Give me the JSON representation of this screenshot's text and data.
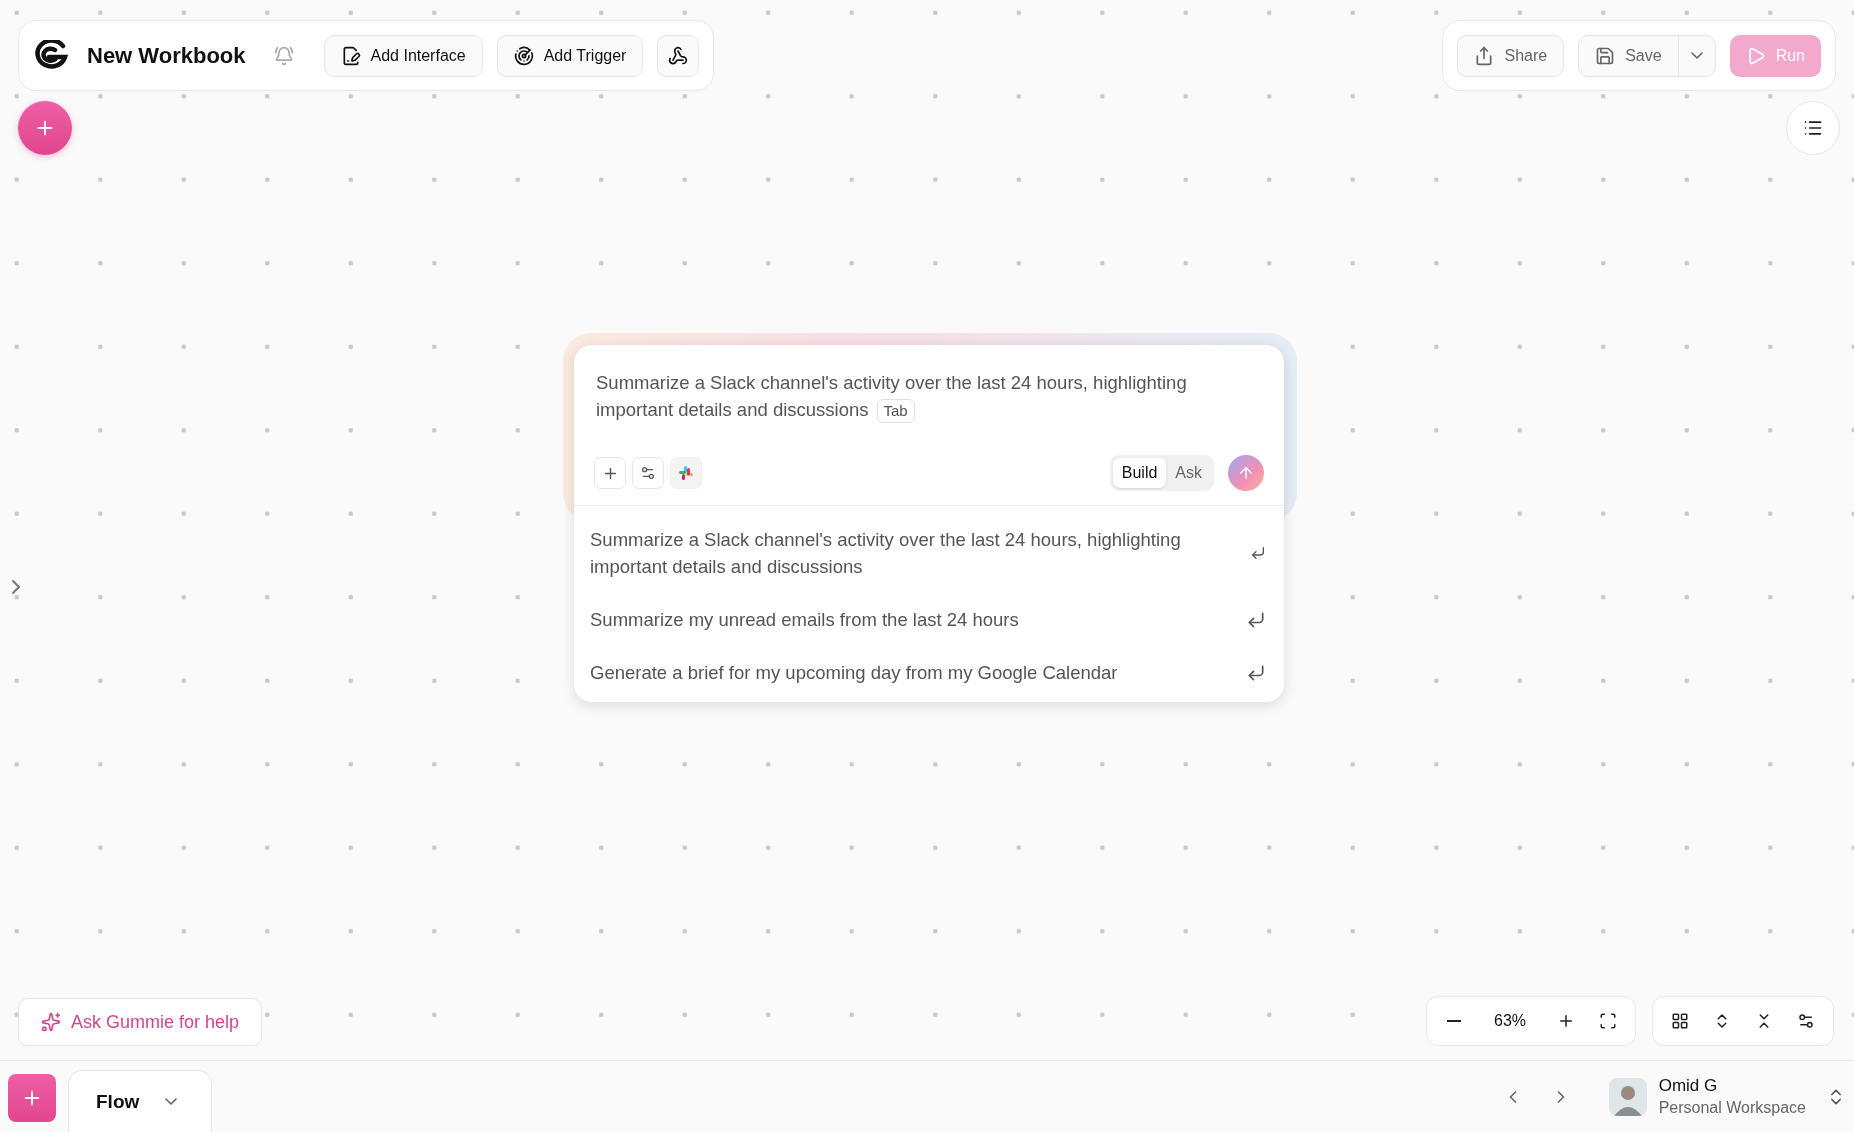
{
  "header": {
    "title": "New Workbook",
    "buttons": [
      {
        "label": "Add Interface",
        "kind": "interface"
      },
      {
        "label": "Add Trigger",
        "kind": "trigger"
      }
    ]
  },
  "actions": {
    "share": "Share",
    "save": "Save",
    "run": {
      "label": "Run",
      "disabled": true
    }
  },
  "prompt": {
    "text": "Summarize a Slack channel's activity over the last 24 hours, highlighting important details and discussions",
    "hint_key": "Tab",
    "modes": [
      {
        "label": "Build",
        "selected": true
      },
      {
        "label": "Ask",
        "selected": false
      }
    ],
    "suggestions": [
      "Summarize a Slack channel's activity over the last 24 hours, highlighting important details and discussions",
      "Summarize my unread emails from the last 24 hours",
      "Generate a brief for my upcoming day from my Google Calendar"
    ]
  },
  "help_button": "Ask Gummie for help",
  "zoom": {
    "level_text": "63%"
  },
  "footer": {
    "tab": "Flow",
    "user": {
      "name": "Omid G",
      "workspace": "Personal Workspace"
    }
  }
}
